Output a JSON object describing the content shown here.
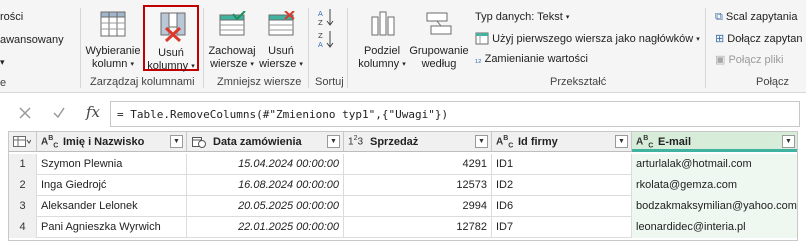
{
  "ribbon": {
    "left_cut": {
      "line1": "rości",
      "line2": "awansowany",
      "line3": "e"
    },
    "group_manage_columns": {
      "label": "Zarządzaj kolumnami",
      "choose_columns": {
        "line1": "Wybieranie",
        "line2": "kolumn"
      },
      "remove_columns": {
        "line1": "Usuń",
        "line2": "kolumny"
      }
    },
    "group_reduce_rows": {
      "label": "Zmniejsz wiersze",
      "keep_rows": {
        "line1": "Zachowaj",
        "line2": "wiersze"
      },
      "remove_rows": {
        "line1": "Usuń",
        "line2": "wiersze"
      }
    },
    "group_sort": {
      "label": "Sortuj"
    },
    "group_transform": {
      "label": "Przekształć",
      "split_column": {
        "line1": "Podziel",
        "line2": "kolumny"
      },
      "group_by": {
        "line1": "Grupowanie",
        "line2": "według"
      },
      "data_type": "Typ danych: Tekst",
      "use_first_row": "Użyj pierwszego wiersza jako nagłówków",
      "replace_values": "Zamienianie wartości"
    },
    "group_combine": {
      "label": "Połącz",
      "merge_queries": "Scal zapytania",
      "append_queries": "Dołącz zapytan",
      "combine_files": "Połącz pliki"
    }
  },
  "formula_bar": {
    "fx": "fx",
    "formula": "= Table.RemoveColumns(#\"Zmieniono typ1\",{\"Uwagi\"})"
  },
  "table": {
    "columns": [
      {
        "type": "ABC",
        "name": "Imię i Nazwisko"
      },
      {
        "type": "date",
        "name": "Data zamówienia"
      },
      {
        "type": "123",
        "name": "Sprzedaż"
      },
      {
        "type": "ABC",
        "name": "Id firmy"
      },
      {
        "type": "ABC",
        "name": "E-mail"
      }
    ],
    "rows": [
      {
        "n": "1",
        "name": "Szymon Plewnia",
        "date": "15.04.2024 00:00:00",
        "sales": "4291",
        "id": "ID1",
        "email": "arturlalak@hotmail.com"
      },
      {
        "n": "2",
        "name": "Inga Giedrojć",
        "date": "16.08.2024 00:00:00",
        "sales": "12573",
        "id": "ID2",
        "email": "rkolata@gemza.com"
      },
      {
        "n": "3",
        "name": "Aleksander Lelonek",
        "date": "20.05.2025 00:00:00",
        "sales": "2994",
        "id": "ID6",
        "email": "bodzakmaksymilian@yahoo.com"
      },
      {
        "n": "4",
        "name": "Pani Agnieszka Wyrwich",
        "date": "22.01.2025 00:00:00",
        "sales": "12782",
        "id": "ID7",
        "email": "leonardidec@interia.pl"
      }
    ]
  },
  "colors": {
    "accent_green": "#3fb2a0",
    "selection_red": "#c00000",
    "header_green": "#d7ecd9"
  }
}
